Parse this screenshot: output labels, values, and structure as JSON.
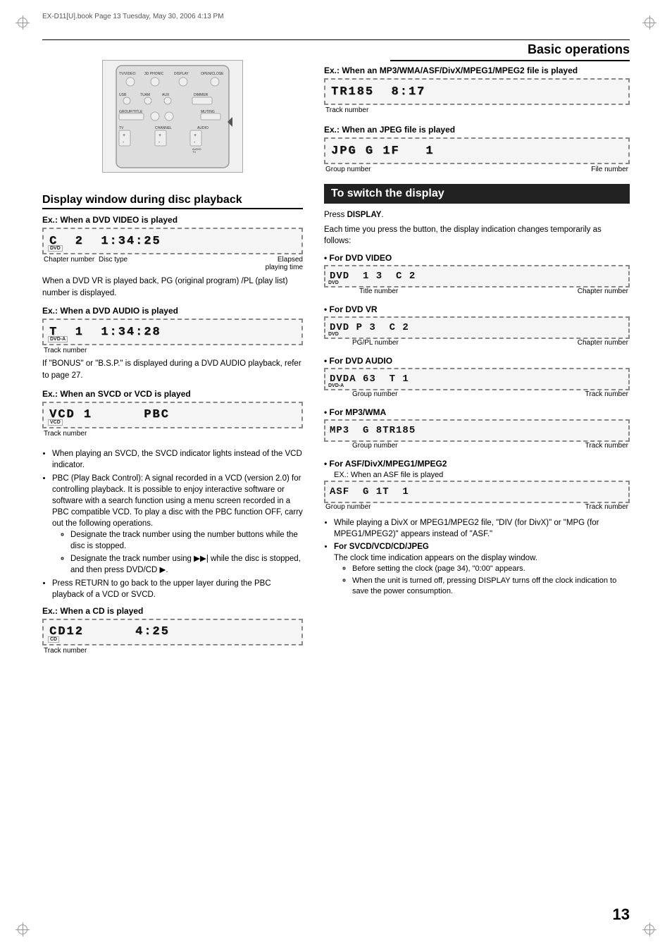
{
  "meta": {
    "file_info": "EX-D11[U].book  Page 13  Tuesday, May 30, 2006  4:13 PM",
    "page_number": "13",
    "page_title": "Basic operations"
  },
  "section_title": "Display window during disc playback",
  "switch_display_title": "To switch the display",
  "examples": {
    "dvd_video": {
      "label": "Ex.:",
      "desc": "When a DVD VIDEO is played",
      "display_text": "C  2  1:34:25",
      "disc_badge": "DVD",
      "labels": {
        "chapter": "Chapter number",
        "disc_type": "Disc type",
        "elapsed": "Elapsed\nplaying time"
      },
      "note": "When a DVD VR is played back, PG (original program) /PL (play list) number is displayed."
    },
    "dvd_audio": {
      "label": "Ex.:",
      "desc": "When a DVD AUDIO is played",
      "display_text": "T  1  1:34:28",
      "disc_badge": "DVD-A",
      "labels": {
        "track": "Track number"
      },
      "note": "If \"BONUS\" or \"B.S.P.\" is displayed during a DVD AUDIO playback, refer to page 27."
    },
    "svcd_vcd": {
      "label": "Ex.:",
      "desc": "When an SVCD or VCD is played",
      "display_text": "VCD 1      PBC",
      "disc_badge": "VCD",
      "labels": {
        "track": "Track number"
      }
    },
    "cd": {
      "label": "Ex.:",
      "desc": "When a CD is played",
      "display_text": "CD12      4:25",
      "disc_badge": "CD",
      "labels": {
        "track": "Track number"
      }
    },
    "mp3wma": {
      "label": "Ex.:",
      "desc": "When an MP3/WMA/ASF/DivX/MPEG1/MPEG2 file is played",
      "display_text": "TR185  8:17",
      "labels": {
        "track": "Track number"
      }
    },
    "jpeg": {
      "label": "Ex.:",
      "desc": "When an JPEG file is played",
      "display_text": "JPG G 1F   1",
      "labels": {
        "group": "Group number",
        "file": "File number"
      }
    }
  },
  "svcd_bullets": [
    "When playing an SVCD, the SVCD indicator lights instead of the VCD indicator.",
    "PBC (Play Back Control): A signal recorded in a VCD (version 2.0) for controlling playback. It is possible to enjoy interactive software or software with a search function using a menu screen recorded in a PBC compatible VCD. To play a disc with the PBC function OFF, carry out the following operations.",
    "Designate the track number using the number buttons while the disc is stopped.",
    "Designate the track number using ▶▶| while the disc is stopped, and then press DVD/CD ▶.",
    "Press RETURN to go back to the upper layer during the PBC playback of a VCD or SVCD."
  ],
  "switch_display": {
    "intro": "Press DISPLAY.",
    "desc": "Each time you press the button, the display indication changes temporarily as follows:",
    "items": [
      {
        "label": "• For DVD VIDEO",
        "display_text": "DVD  1 3  C 2",
        "disc_badge": "DVD",
        "sub_labels": [
          "Title number",
          "Chapter number"
        ]
      },
      {
        "label": "• For DVD VR",
        "display_text": "DVD P 3  C 2",
        "disc_badge": "DVD",
        "sub_labels": [
          "PG/PL number",
          "Chapter number"
        ]
      },
      {
        "label": "• For DVD AUDIO",
        "display_text": "DVDA 63  T 1",
        "disc_badge": "DVD-A",
        "sub_labels": [
          "Group number",
          "Track number"
        ]
      },
      {
        "label": "• For MP3/WMA",
        "display_text": "MP3  G 8TR185",
        "sub_labels": [
          "Group number",
          "Track number"
        ]
      },
      {
        "label": "• For ASF/DivX/MPEG1/MPEG2",
        "ex_note": "EX.: When an ASF file is played",
        "display_text": "ASF  G 1T  1",
        "sub_labels": [
          "Group number",
          "Track number"
        ]
      }
    ],
    "bullets_after": [
      "While playing a DivX or MPEG1/MPEG2 file, \"DIV (for DivX)\" or \"MPG (for MPEG1/MPEG2)\" appears instead of \"ASF.\"",
      "For SVCD/VCD/CD/JPEG",
      "The clock time indication appears on the display window.",
      "Before setting the clock (page 34), \"0:00\" appears.",
      "When the unit is turned off, pressing DISPLAY turns off the clock indication to save the power consumption."
    ]
  }
}
